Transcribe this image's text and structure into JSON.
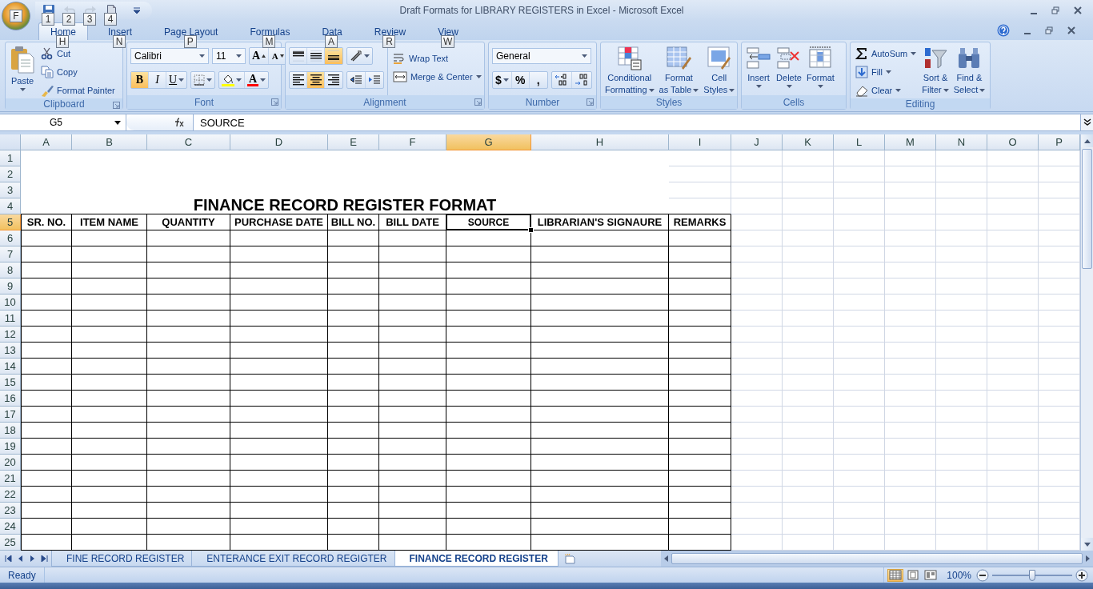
{
  "window": {
    "title": "Draft Formats for LIBRARY REGISTERS in Excel - Microsoft Excel",
    "office_keytip": "F"
  },
  "quick_access": [
    {
      "kind": "save",
      "keytip": "1",
      "disabled": false
    },
    {
      "kind": "undo",
      "keytip": "2",
      "disabled": true
    },
    {
      "kind": "redo",
      "keytip": "3",
      "disabled": true
    },
    {
      "kind": "print",
      "keytip": "4",
      "disabled": false
    }
  ],
  "tabs": [
    {
      "label": "Home",
      "keytip": "H",
      "selected": true
    },
    {
      "label": "Insert",
      "keytip": "N",
      "selected": false
    },
    {
      "label": "Page Layout",
      "keytip": "P",
      "selected": false
    },
    {
      "label": "Formulas",
      "keytip": "M",
      "selected": false
    },
    {
      "label": "Data",
      "keytip": "A",
      "selected": false
    },
    {
      "label": "Review",
      "keytip": "R",
      "selected": false
    },
    {
      "label": "View",
      "keytip": "W",
      "selected": false
    }
  ],
  "ribbon": [
    {
      "kind": "clipboard",
      "label": "Clipboard",
      "paste": "Paste",
      "items": [
        {
          "kind": "cut",
          "label": "Cut"
        },
        {
          "kind": "copy",
          "label": "Copy"
        },
        {
          "kind": "painter",
          "label": "Format Painter"
        }
      ]
    },
    {
      "kind": "font",
      "label": "Font",
      "font_name": "Calibri",
      "font_size": "11",
      "grow": "A",
      "shrink": "A",
      "styles": [
        {
          "text": "B",
          "kind": "bold",
          "on": true
        },
        {
          "text": "I",
          "kind": "italic",
          "on": false
        },
        {
          "text": "U",
          "kind": "underline",
          "on": false
        }
      ],
      "font_color": "A"
    },
    {
      "kind": "alignment",
      "label": "Alignment",
      "vertical": [
        {
          "kind": "top",
          "on": false
        },
        {
          "kind": "middle",
          "on": false
        },
        {
          "kind": "bottom",
          "on": true
        }
      ],
      "horizontal": [
        {
          "kind": "left",
          "on": false
        },
        {
          "kind": "center",
          "on": true
        },
        {
          "kind": "right",
          "on": false
        }
      ],
      "wrap": "Wrap Text",
      "merge": "Merge & Center"
    },
    {
      "kind": "number",
      "label": "Number",
      "format": "General",
      "symbols": [
        "$",
        "%",
        ","
      ]
    },
    {
      "kind": "styles",
      "label": "Styles",
      "buttons": [
        {
          "kind": "conditional",
          "lines": [
            "Conditional",
            "Formatting"
          ]
        },
        {
          "kind": "table",
          "lines": [
            "Format",
            "as Table"
          ]
        },
        {
          "kind": "cellstyles",
          "lines": [
            "Cell",
            "Styles"
          ]
        }
      ]
    },
    {
      "kind": "cells",
      "label": "Cells",
      "buttons": [
        {
          "kind": "insert",
          "lines": [
            "Insert"
          ]
        },
        {
          "kind": "delete",
          "lines": [
            "Delete"
          ]
        },
        {
          "kind": "format",
          "lines": [
            "Format"
          ]
        }
      ]
    },
    {
      "kind": "editing",
      "label": "Editing",
      "items": [
        {
          "kind": "sum",
          "label": "AutoSum"
        },
        {
          "kind": "fill",
          "label": "Fill"
        },
        {
          "kind": "clear",
          "label": "Clear"
        }
      ],
      "buttons": [
        {
          "kind": "sort",
          "lines": [
            "Sort &",
            "Filter"
          ]
        },
        {
          "kind": "find",
          "lines": [
            "Find &",
            "Select"
          ]
        }
      ]
    }
  ],
  "formula_bar": {
    "name_box": "G5",
    "value": "SOURCE"
  },
  "sheet": {
    "columns": [
      {
        "label": "A",
        "selected": false
      },
      {
        "label": "B",
        "selected": false
      },
      {
        "label": "C",
        "selected": false
      },
      {
        "label": "D",
        "selected": false
      },
      {
        "label": "E",
        "selected": false
      },
      {
        "label": "F",
        "selected": false
      },
      {
        "label": "G",
        "selected": true
      },
      {
        "label": "H",
        "selected": false
      },
      {
        "label": "I",
        "selected": false
      },
      {
        "label": "J",
        "selected": false
      },
      {
        "label": "K",
        "selected": false
      },
      {
        "label": "L",
        "selected": false
      },
      {
        "label": "M",
        "selected": false
      },
      {
        "label": "N",
        "selected": false
      },
      {
        "label": "O",
        "selected": false
      },
      {
        "label": "P",
        "selected": false
      }
    ],
    "rows": [
      {
        "label": "1",
        "selected": false
      },
      {
        "label": "2",
        "selected": false
      },
      {
        "label": "3",
        "selected": false
      },
      {
        "label": "4",
        "selected": false
      },
      {
        "label": "5",
        "selected": true
      },
      {
        "label": "6",
        "selected": false
      },
      {
        "label": "7",
        "selected": false
      },
      {
        "label": "8",
        "selected": false
      },
      {
        "label": "9",
        "selected": false
      },
      {
        "label": "10",
        "selected": false
      },
      {
        "label": "11",
        "selected": false
      },
      {
        "label": "12",
        "selected": false
      },
      {
        "label": "13",
        "selected": false
      },
      {
        "label": "14",
        "selected": false
      },
      {
        "label": "15",
        "selected": false
      },
      {
        "label": "16",
        "selected": false
      },
      {
        "label": "17",
        "selected": false
      },
      {
        "label": "18",
        "selected": false
      },
      {
        "label": "19",
        "selected": false
      },
      {
        "label": "20",
        "selected": false
      },
      {
        "label": "21",
        "selected": false
      },
      {
        "label": "22",
        "selected": false
      },
      {
        "label": "23",
        "selected": false
      },
      {
        "label": "24",
        "selected": false
      },
      {
        "label": "25",
        "selected": false
      }
    ],
    "title": "FINANCE RECORD REGISTER FORMAT",
    "headers": [
      {
        "text": "SR. NO.",
        "selected": false
      },
      {
        "text": "ITEM NAME",
        "selected": false
      },
      {
        "text": "QUANTITY",
        "selected": false
      },
      {
        "text": "PURCHASE DATE",
        "selected": false
      },
      {
        "text": "BILL NO.",
        "selected": false
      },
      {
        "text": "BILL DATE",
        "selected": false
      },
      {
        "text": "SOURCE",
        "selected": true
      },
      {
        "text": "LIBRARIAN'S SIGNAURE",
        "selected": false
      },
      {
        "text": "REMARKS",
        "selected": false
      }
    ]
  },
  "sheet_tabs": [
    {
      "label": "FINE RECORD REGISTER",
      "selected": false
    },
    {
      "label": "ENTERANCE EXIT RECORD REGIGTER",
      "selected": false
    },
    {
      "label": "FINANCE RECORD REGISTER",
      "selected": true
    }
  ],
  "status_bar": {
    "text": "Ready",
    "views": [
      {
        "kind": "normal",
        "selected": true
      },
      {
        "kind": "layout",
        "selected": false
      },
      {
        "kind": "pagebreak",
        "selected": false
      }
    ],
    "zoom": "100%",
    "zoom_slider": {
      "level": 0.5
    }
  }
}
